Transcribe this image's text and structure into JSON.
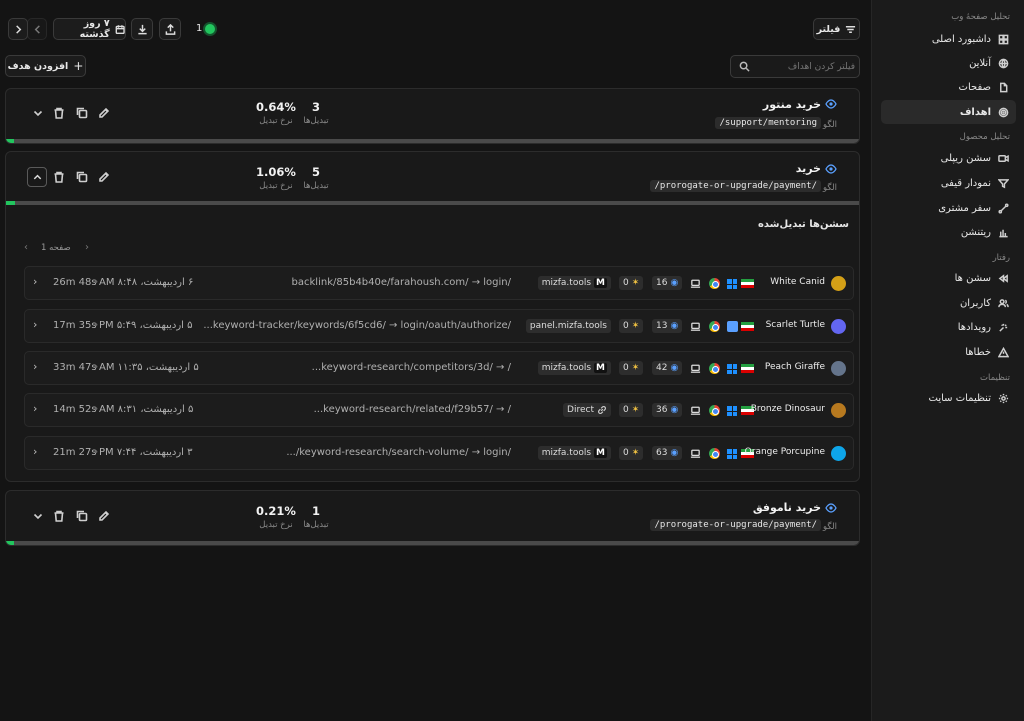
{
  "sidebar": {
    "section_web": "تحلیل صفحهٔ وب",
    "section_product": "تحلیل محصول",
    "section_behavior": "رفتار",
    "section_settings": "تنظیمات",
    "items": [
      {
        "label": "داشبورد اصلی",
        "icon": "dashboard-icon"
      },
      {
        "label": "آنلاین",
        "icon": "globe-icon"
      },
      {
        "label": "صفحات",
        "icon": "pages-icon"
      },
      {
        "label": "اهداف",
        "icon": "target-icon",
        "active": true
      },
      {
        "label": "سشن ریپلی",
        "icon": "video-icon"
      },
      {
        "label": "نمودار قیفی",
        "icon": "funnel-icon"
      },
      {
        "label": "سفر مشتری",
        "icon": "journey-icon"
      },
      {
        "label": "ریتنشن",
        "icon": "retention-icon"
      },
      {
        "label": "سشن ها",
        "icon": "sessions-icon"
      },
      {
        "label": "کاربران",
        "icon": "users-icon"
      },
      {
        "label": "رویدادها",
        "icon": "events-icon"
      },
      {
        "label": "خطاها",
        "icon": "warning-icon"
      },
      {
        "label": "تنظیمات سایت",
        "icon": "gear-icon"
      }
    ]
  },
  "toolbar": {
    "filter_label": "فیلتر",
    "date_label": "۷ روز گذشته",
    "online_count": "1",
    "online_color": "#22c55e",
    "add_goal_label": "افزودن هدف",
    "search_placeholder": "فیلتر کردن اهداف"
  },
  "goals": [
    {
      "title": "خرید منتور",
      "pattern_label": "الگو",
      "pattern": "/support/mentoring",
      "conversions": "3",
      "conversions_label": "تبدیل‌ها",
      "rate": "0.64%",
      "rate_label": "نرخ تبدیل",
      "progress": 0.0064
    },
    {
      "title": "خرید",
      "pattern_label": "الگو",
      "pattern": "/prorogate-or-upgrade/payment/",
      "conversions": "5",
      "conversions_label": "تبدیل‌ها",
      "rate": "1.06%",
      "rate_label": "نرخ تبدیل",
      "progress": 0.0106,
      "expanded": true
    },
    {
      "title": "خرید ناموفق",
      "pattern_label": "الگو",
      "pattern": "/prorogate-or-upgrade/payment/",
      "conversions": "1",
      "conversions_label": "تبدیل‌ها",
      "rate": "0.21%",
      "rate_label": "نرخ تبدیل",
      "progress": 0.0021
    }
  ],
  "sessions": {
    "title": "سشن‌ها تبدیل‌شده",
    "page_label": "صفحه 1",
    "rows": [
      {
        "name": "White Canid",
        "avatar_color": "#d4a017",
        "views": "16",
        "events": "0",
        "source": "mizfa.tools",
        "source_badge": "M",
        "path": "backlink/85b4b40e/farahoush.com/ → login/",
        "date": "۶ اردیبهشت، AM ۸:۴۸",
        "duration": "26m 48s",
        "os": "windows"
      },
      {
        "name": "Scarlet Turtle",
        "avatar_color": "#6366f1",
        "views": "13",
        "events": "0",
        "source": "panel.mizfa.tools",
        "source_badge": "",
        "path": "...keyword-tracker/keywords/6f5cd6/ → login/oauth/authorize/",
        "date": "۵ اردیبهشت، PM ۵:۴۹",
        "duration": "17m 35s",
        "os": "mac"
      },
      {
        "name": "Peach Giraffe",
        "avatar_color": "#64748b",
        "views": "42",
        "events": "0",
        "source": "mizfa.tools",
        "source_badge": "M",
        "path": "...keyword-research/competitors/3d/ → /",
        "date": "۵ اردیبهشت، AM ۱۱:۳۵",
        "duration": "33m 47s",
        "os": "windows"
      },
      {
        "name": "Bronze Dinosaur",
        "avatar_color": "#b7791f",
        "views": "36",
        "events": "0",
        "source": "Direct",
        "source_badge": "",
        "path": "...keyword-research/related/f29b57/ → /",
        "date": "۵ اردیبهشت، AM ۸:۳۱",
        "duration": "14m 52s",
        "os": "windows"
      },
      {
        "name": "Orange Porcupine",
        "avatar_color": "#0ea5e9",
        "views": "63",
        "events": "0",
        "source": "mizfa.tools",
        "source_badge": "M",
        "path": ".../keyword-research/search-volume/ → login/",
        "date": "۳ اردیبهشت، PM ۷:۴۴",
        "duration": "21m 27s",
        "os": "windows"
      }
    ]
  }
}
